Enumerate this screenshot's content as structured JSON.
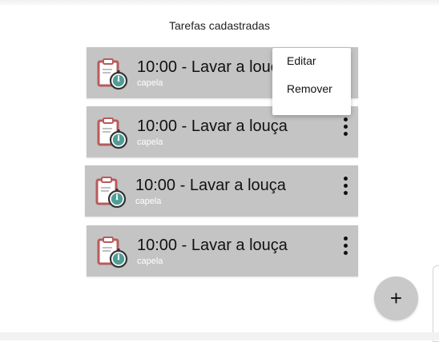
{
  "page": {
    "title": "Tarefas cadastradas"
  },
  "tasks": [
    {
      "title": "10:00 - Lavar a louça",
      "subtitle": "capela"
    },
    {
      "title": "10:00 - Lavar a louça",
      "subtitle": "capela"
    },
    {
      "title": "10:00 - Lavar a louça",
      "subtitle": "capela"
    },
    {
      "title": "10:00 - Lavar a louça",
      "subtitle": "capela"
    }
  ],
  "context_menu": {
    "edit_label": "Editar",
    "remove_label": "Remover"
  },
  "fab": {
    "label": "+"
  },
  "icons": {
    "task": "clipboard-stopwatch-icon",
    "more": "more-vertical-icon"
  },
  "colors": {
    "card_background": "#c4c4c4",
    "fab_background": "#c9c9c9",
    "stopwatch_teal": "#4f9e96",
    "clipboard_red": "#b85b5b"
  }
}
